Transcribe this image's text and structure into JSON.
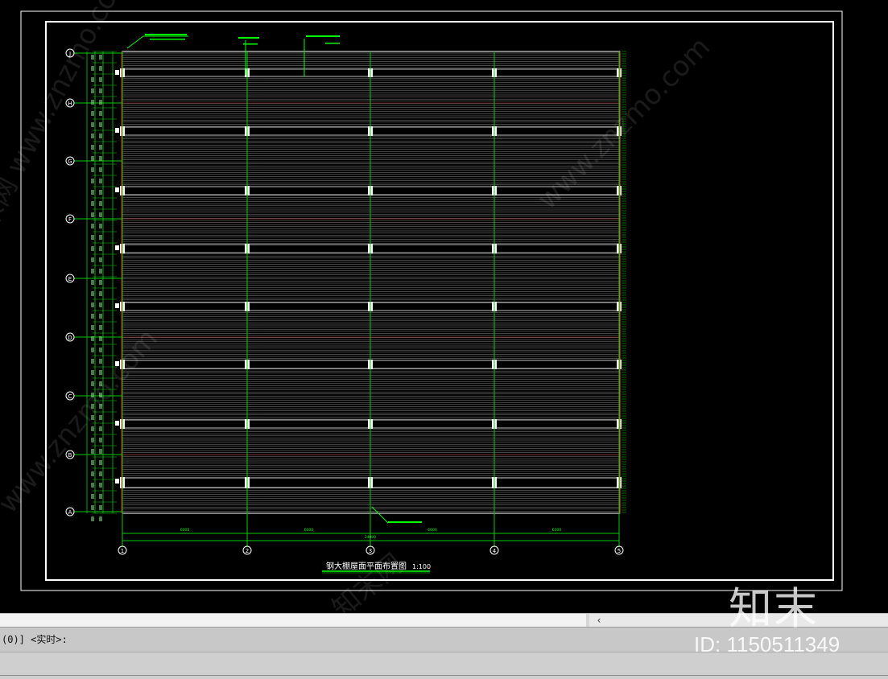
{
  "drawing": {
    "title": "钢大棚屋面平面布置图",
    "scale": "1:100",
    "overall_dimension": "24000",
    "bay_dimensions": [
      "6000",
      "6000",
      "6000",
      "6000"
    ],
    "column_axes": [
      "1",
      "2",
      "3",
      "4",
      "5"
    ],
    "row_axes": [
      "J",
      "H",
      "G",
      "F",
      "E",
      "D",
      "C",
      "B",
      "A"
    ],
    "colors": {
      "background": "#000000",
      "frame": "#ffffff",
      "axis_line": "#00cc00",
      "annotation": "#00ff00",
      "red_line": "#ff2020",
      "text": "#ffffff"
    }
  },
  "command_line": {
    "prompt": "(0)] <实时>:"
  },
  "scrollbar": {
    "arrow": "‹"
  },
  "watermark": {
    "logo": "知末",
    "id": "ID: 1150511349",
    "texts": [
      "知末网 www.znzmo.com",
      "www.znzmo.com",
      "知末网",
      "www.znzmo.com"
    ]
  }
}
